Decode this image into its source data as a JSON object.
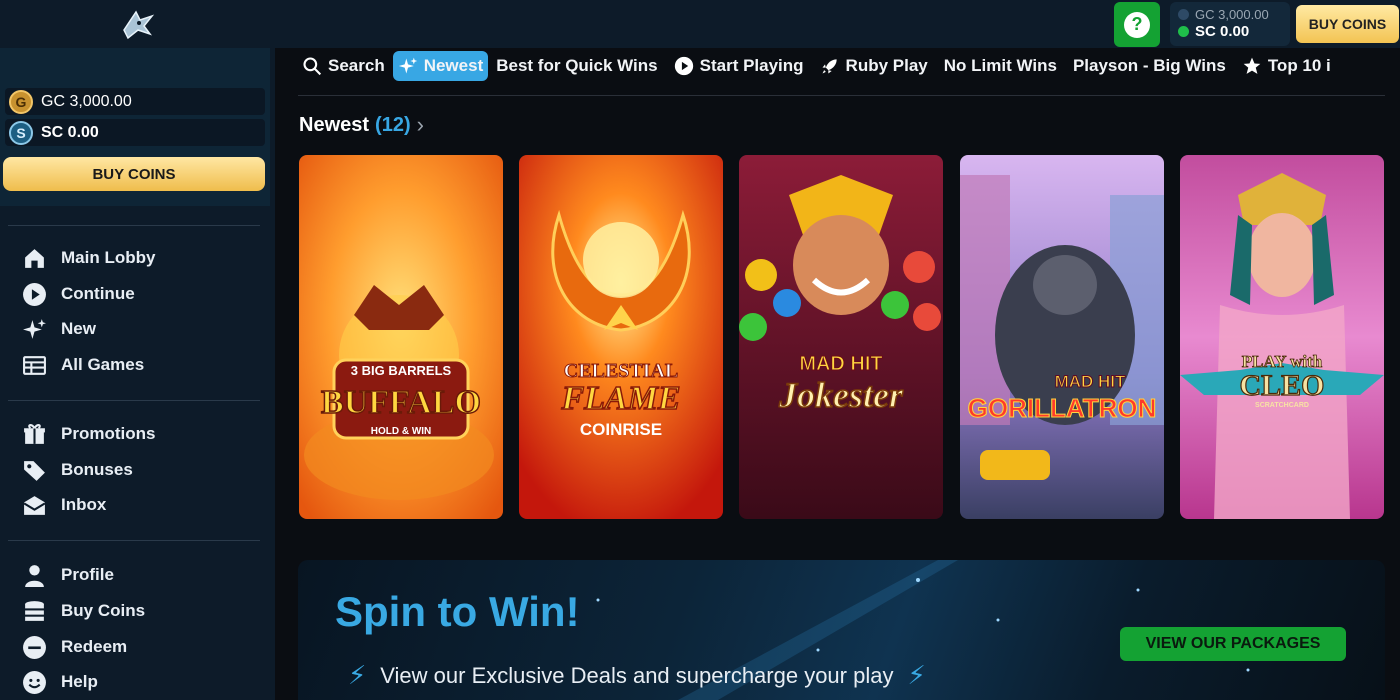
{
  "header": {
    "logo_icon": "shark-logo-icon",
    "help_icon": "question-icon",
    "balance": {
      "gc": "GC 3,000.00",
      "sc": "SC 0.00"
    },
    "buy_label": "BUY COINS"
  },
  "sidebar": {
    "balance": {
      "gc_symbol": "G",
      "gc": "GC 3,000.00",
      "sc_symbol": "S",
      "sc": "SC 0.00"
    },
    "buy_label": "BUY COINS",
    "nav": [
      {
        "label": "Main Lobby",
        "icon": "home-icon"
      },
      {
        "label": "Continue",
        "icon": "play-circle-icon"
      },
      {
        "label": "New",
        "icon": "sparkles-icon"
      },
      {
        "label": "All Games",
        "icon": "table-icon"
      },
      {
        "label": "Promotions",
        "icon": "gift-icon"
      },
      {
        "label": "Bonuses",
        "icon": "tag-icon"
      },
      {
        "label": "Inbox",
        "icon": "mail-icon"
      },
      {
        "label": "Profile",
        "icon": "user-icon"
      },
      {
        "label": "Buy Coins",
        "icon": "coin-stack-icon"
      },
      {
        "label": "Redeem",
        "icon": "minus-circle-icon"
      },
      {
        "label": "Help",
        "icon": "smile-icon"
      }
    ]
  },
  "categories": [
    {
      "label": "Search",
      "icon": "search-icon"
    },
    {
      "label": "Newest",
      "icon": "sparkles-icon",
      "active": true
    },
    {
      "label": "Best for Quick Wins",
      "icon": ""
    },
    {
      "label": "Start Playing",
      "icon": "play-circle-icon"
    },
    {
      "label": "Ruby Play",
      "icon": "rocket-icon"
    },
    {
      "label": "No Limit Wins",
      "icon": ""
    },
    {
      "label": "Playson - Big Wins",
      "icon": ""
    },
    {
      "label": "Top 10 i",
      "icon": "star-icon"
    }
  ],
  "section": {
    "title": "Newest",
    "count": "(12)",
    "chevron": "›"
  },
  "games": [
    {
      "title": "BUFFALO",
      "subtitle": "3 BIG BARRELS",
      "tag": "HOLD & WIN",
      "colors": [
        "#ffb13b",
        "#f06a12"
      ]
    },
    {
      "title": "FLAME",
      "subtitle": "CELESTIAL",
      "tag": "COINRISE",
      "colors": [
        "#ff4a1a",
        "#c8150c"
      ]
    },
    {
      "title": "Jokester",
      "subtitle": "MAD HIT",
      "tag": "",
      "colors": [
        "#7a1530",
        "#3d0a18"
      ]
    },
    {
      "title": "GORILLATRON",
      "subtitle": "MAD HIT",
      "tag": "",
      "colors": [
        "#c9a4e8",
        "#6b7fc4"
      ]
    },
    {
      "title": "CLEO",
      "subtitle": "PLAY with",
      "tag": "SCRATCHCARD",
      "colors": [
        "#d96bb8",
        "#8e2e6b"
      ]
    }
  ],
  "banner": {
    "title": "Spin to Win!",
    "subtitle": "View our Exclusive Deals and supercharge your play",
    "bolt_icon": "lightning-icon",
    "button_label": "VIEW OUR PACKAGES"
  },
  "colors": {
    "accent": "#38a7e4",
    "green": "#14a233",
    "gold": "#f3c453",
    "sidebar_bg": "#0d1b29"
  }
}
